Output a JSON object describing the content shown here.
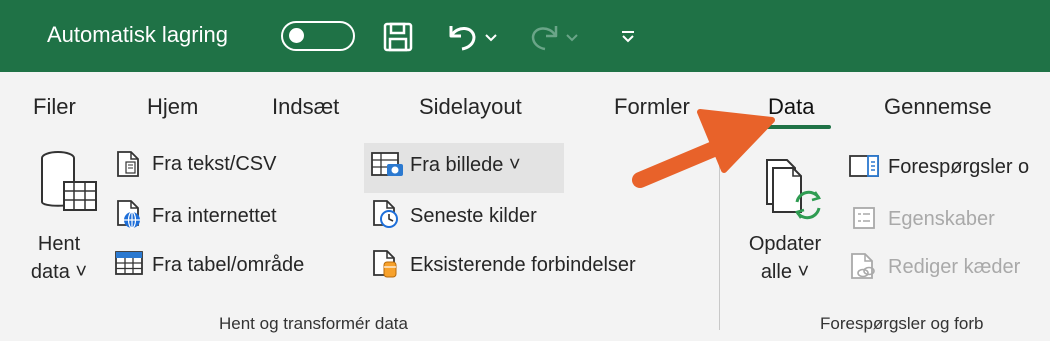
{
  "titlebar": {
    "autosave_label": "Automatisk lagring",
    "qat_icons": [
      "save-icon",
      "undo-icon",
      "redo-icon",
      "customize-qat-icon"
    ]
  },
  "tabs": [
    {
      "label": "Filer"
    },
    {
      "label": "Hjem"
    },
    {
      "label": "Indsæt"
    },
    {
      "label": "Sidelayout"
    },
    {
      "label": "Formler"
    },
    {
      "label": "Data",
      "active": true
    },
    {
      "label": "Gennemse"
    }
  ],
  "groups": {
    "get_transform": {
      "get_data_line1": "Hent",
      "get_data_line2": "data ˅",
      "from_text_csv": "Fra tekst/CSV",
      "from_web": "Fra internettet",
      "from_table": "Fra tabel/område",
      "from_picture": "Fra billede ˅",
      "recent_sources": "Seneste kilder",
      "existing_connections": "Eksisterende forbindelser",
      "label": "Hent og transformér data"
    },
    "queries": {
      "refresh_line1": "Opdater",
      "refresh_line2": "alle ˅",
      "queries_connections": "Forespørgsler o",
      "properties": "Egenskaber",
      "edit_links": "Rediger kæder",
      "label": "Forespørgsler og forb"
    }
  },
  "colors": {
    "titlebar": "#1f7246",
    "accent": "#1f7246",
    "arrow": "#e8622a",
    "ribbon": "#f3f3f3"
  }
}
